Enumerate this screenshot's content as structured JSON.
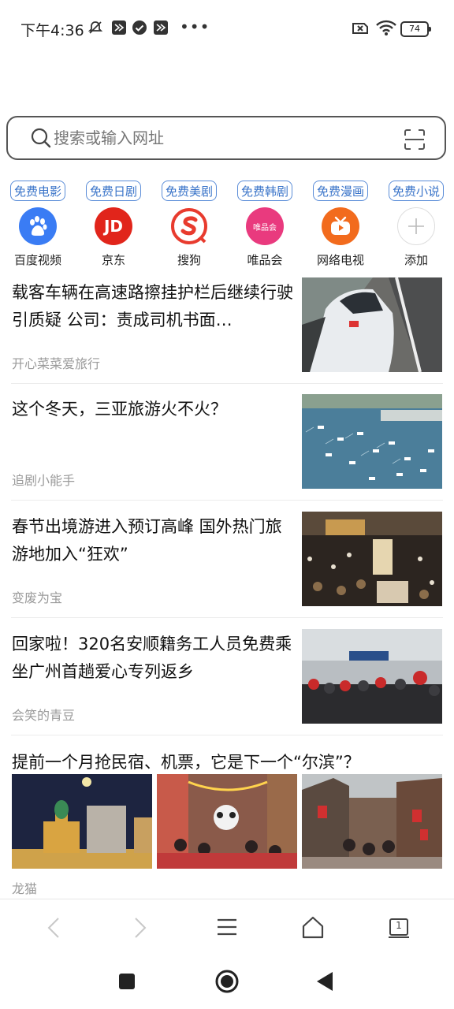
{
  "status_bar": {
    "time": "下午4:36",
    "battery": "74"
  },
  "search": {
    "placeholder": "搜索或输入网址"
  },
  "free_tags": [
    "免费电影",
    "免费日剧",
    "免费美剧",
    "免费韩剧",
    "免费漫画",
    "免费小说"
  ],
  "shortcuts": [
    {
      "label": "百度视频",
      "icon": "baidu-paw-icon",
      "color": "#3a7cf4"
    },
    {
      "label": "京东",
      "icon": "jd-logo-icon",
      "text": "JD",
      "color": "#e1251b"
    },
    {
      "label": "搜狗",
      "icon": "sogou-logo-icon",
      "color": "#e83b2e"
    },
    {
      "label": "唯品会",
      "icon": "vip-logo-icon",
      "text": "唯品会",
      "color": "#e93a7e"
    },
    {
      "label": "网络电视",
      "icon": "tv-logo-icon",
      "color": "#f26b1d"
    },
    {
      "label": "添加",
      "icon": "add-icon"
    }
  ],
  "feed": [
    {
      "title": "载客车辆在高速路擦挂护栏后继续行驶引质疑 公司：责成司机书面…",
      "source": "开心菜菜爱旅行"
    },
    {
      "title": "这个冬天，三亚旅游火不火？",
      "source": "追剧小能手"
    },
    {
      "title": "春节出境游进入预订高峰 国外热门旅游地加入“狂欢”",
      "source": "变废为宝"
    },
    {
      "title": "回家啦！320名安顺籍务工人员免费乘坐广州首趟爱心专列返乡",
      "source": "会笑的青豆"
    },
    {
      "title": "提前一个月抢民宿、机票，它是下一个“尔滨”？",
      "source": "龙猫"
    }
  ],
  "browser_nav": {
    "tab_count": "1"
  },
  "colors": {
    "accent_blue": "#3a74c9",
    "text_gray": "#9a9a9a"
  }
}
